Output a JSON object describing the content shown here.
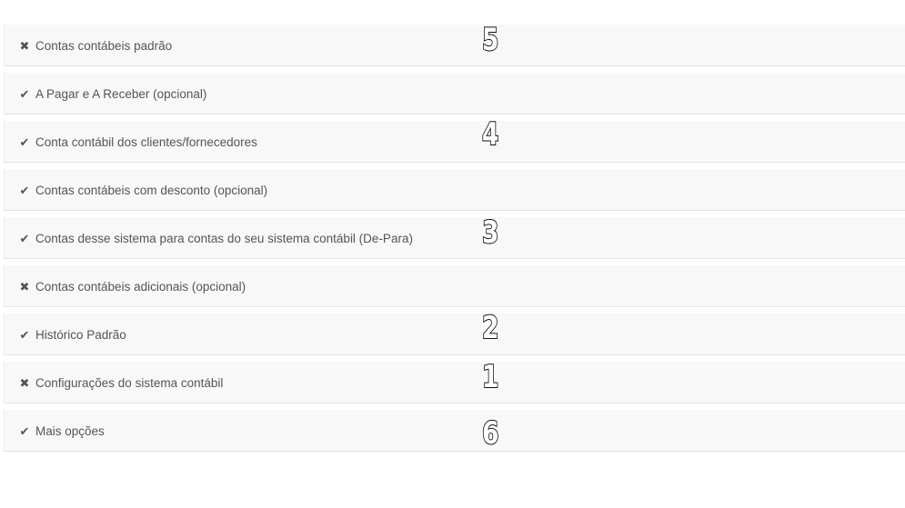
{
  "items": [
    {
      "icon": "✖",
      "icon_name": "x-icon",
      "label": "Contas contábeis padrão"
    },
    {
      "icon": "✔",
      "icon_name": "check-icon",
      "label": "A Pagar e A Receber (opcional)"
    },
    {
      "icon": "✔",
      "icon_name": "check-icon",
      "label": "Conta contábil dos clientes/fornecedores"
    },
    {
      "icon": "✔",
      "icon_name": "check-icon",
      "label": "Contas contábeis com desconto (opcional)"
    },
    {
      "icon": "✔",
      "icon_name": "check-icon",
      "label": "Contas desse sistema para contas do seu sistema contábil (De-Para)"
    },
    {
      "icon": "✖",
      "icon_name": "x-icon",
      "label": "Contas contábeis adicionais (opcional)"
    },
    {
      "icon": "✔",
      "icon_name": "check-icon",
      "label": "Histórico Padrão"
    },
    {
      "icon": "✖",
      "icon_name": "x-icon",
      "label": "Configurações do sistema contábil"
    },
    {
      "icon": "✔",
      "icon_name": "check-icon",
      "label": "Mais opções"
    }
  ],
  "annotations": {
    "n5": "5",
    "n4": "4",
    "n3": "3",
    "n2": "2",
    "n1": "1",
    "n6": "6"
  },
  "colors": {
    "row_background": "#f8f8f8",
    "text": "#555555"
  }
}
